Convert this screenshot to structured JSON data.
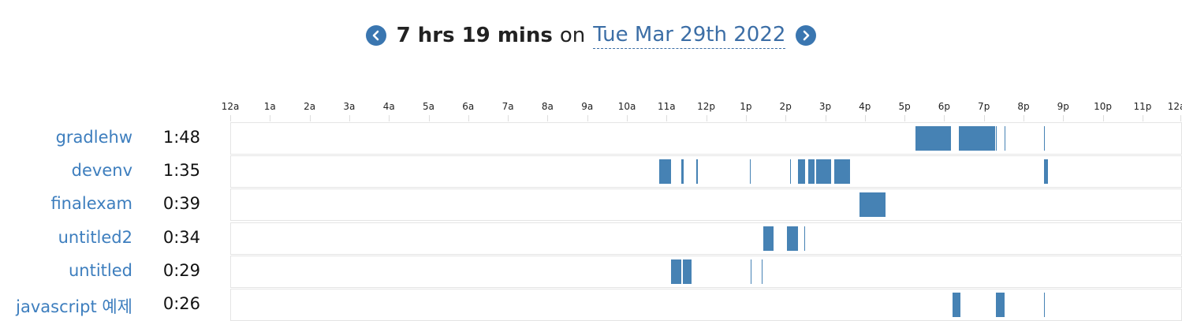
{
  "header": {
    "total": "7 hrs 19 mins",
    "on": "on",
    "date": "Tue Mar 29th 2022",
    "prev_icon": "chevron-left-icon",
    "next_icon": "chevron-right-icon"
  },
  "colors": {
    "accent": "#3a76b0",
    "link": "#3c6ea6",
    "bar": "#4682b4"
  },
  "chart_data": {
    "type": "timeline",
    "x_ticks": [
      "12a",
      "1a",
      "2a",
      "3a",
      "4a",
      "5a",
      "6a",
      "7a",
      "8a",
      "9a",
      "10a",
      "11a",
      "12p",
      "1p",
      "2p",
      "3p",
      "4p",
      "5p",
      "6p",
      "7p",
      "8p",
      "9p",
      "10p",
      "11p",
      "12a"
    ],
    "xlim_hours": [
      0,
      24
    ],
    "rows": [
      {
        "name": "gradlehw",
        "duration": "1:48",
        "segments": [
          [
            17.26,
            17.5
          ],
          [
            17.5,
            18.15
          ],
          [
            18.35,
            19.27
          ],
          [
            19.28,
            19.3
          ],
          [
            19.5,
            19.52
          ],
          [
            20.5,
            20.52
          ]
        ]
      },
      {
        "name": "devenv",
        "duration": "1:35",
        "segments": [
          [
            10.8,
            11.1
          ],
          [
            11.35,
            11.42
          ],
          [
            11.72,
            11.76
          ],
          [
            13.08,
            13.1
          ],
          [
            14.1,
            14.12
          ],
          [
            14.3,
            14.48
          ],
          [
            14.55,
            14.72
          ],
          [
            14.76,
            15.12
          ],
          [
            15.2,
            15.6
          ],
          [
            20.5,
            20.6
          ]
        ]
      },
      {
        "name": "finalexam",
        "duration": "0:39",
        "segments": [
          [
            15.85,
            16.5
          ]
        ]
      },
      {
        "name": "untitled2",
        "duration": "0:34",
        "segments": [
          [
            13.42,
            13.67
          ],
          [
            14.02,
            14.3
          ],
          [
            14.45,
            14.47
          ]
        ]
      },
      {
        "name": "untitled",
        "duration": "0:29",
        "segments": [
          [
            11.1,
            11.35
          ],
          [
            11.4,
            11.62
          ],
          [
            13.1,
            13.12
          ],
          [
            13.38,
            13.4
          ]
        ]
      },
      {
        "name": "javascript 예제",
        "duration": "0:26",
        "segments": [
          [
            18.2,
            18.38
          ],
          [
            19.28,
            19.5
          ],
          [
            20.5,
            20.52
          ]
        ]
      }
    ]
  }
}
